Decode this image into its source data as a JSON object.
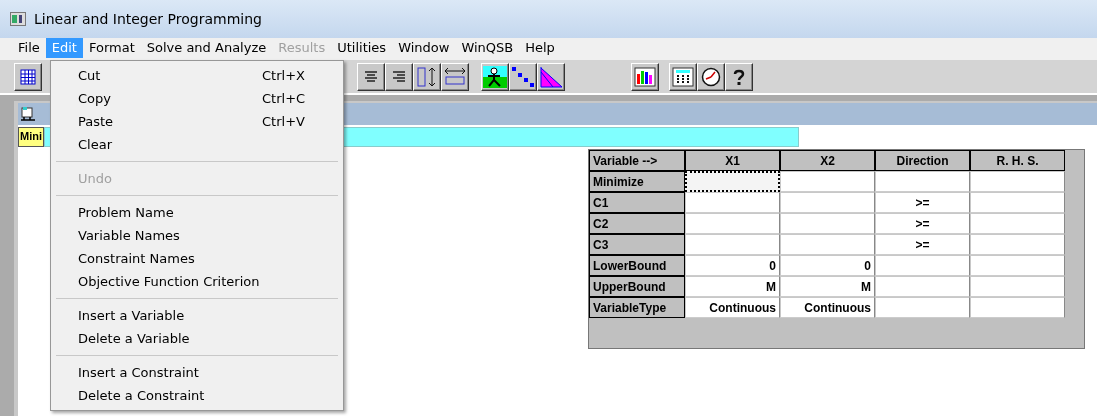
{
  "window": {
    "title": "Linear and Integer Programming"
  },
  "menu_bar": [
    {
      "label": "File",
      "selected": false,
      "disabled": false
    },
    {
      "label": "Edit",
      "selected": true,
      "disabled": false
    },
    {
      "label": "Format",
      "selected": false,
      "disabled": false
    },
    {
      "label": "Solve and Analyze",
      "selected": false,
      "disabled": false
    },
    {
      "label": "Results",
      "selected": false,
      "disabled": true
    },
    {
      "label": "Utilities",
      "selected": false,
      "disabled": false
    },
    {
      "label": "Window",
      "selected": false,
      "disabled": false
    },
    {
      "label": "WinQSB",
      "selected": false,
      "disabled": false
    },
    {
      "label": "Help",
      "selected": false,
      "disabled": false
    }
  ],
  "edit_menu": [
    [
      {
        "label": "Cut",
        "shortcut": "Ctrl+X",
        "disabled": false
      },
      {
        "label": "Copy",
        "shortcut": "Ctrl+C",
        "disabled": false
      },
      {
        "label": "Paste",
        "shortcut": "Ctrl+V",
        "disabled": false
      },
      {
        "label": "Clear",
        "disabled": false
      }
    ],
    [
      {
        "label": "Undo",
        "disabled": true
      }
    ],
    [
      {
        "label": "Problem Name",
        "disabled": false
      },
      {
        "label": "Variable Names",
        "disabled": false
      },
      {
        "label": "Constraint Names",
        "disabled": false
      },
      {
        "label": "Objective Function Criterion",
        "disabled": false
      }
    ],
    [
      {
        "label": "Insert a Variable",
        "disabled": false
      },
      {
        "label": "Delete a Variable",
        "disabled": false
      }
    ],
    [
      {
        "label": "Insert a Constraint",
        "disabled": false
      },
      {
        "label": "Delete a Constraint",
        "disabled": false
      }
    ]
  ],
  "document": {
    "cell_label": "Mini",
    "table": {
      "columns": [
        "Variable -->",
        "X1",
        "X2",
        "Direction",
        "R. H. S."
      ],
      "rows": [
        {
          "cells": [
            {
              "kind": "header",
              "text": "Minimize"
            },
            {
              "focused": true
            },
            {
              "focused": false
            },
            {
              "focused": false
            },
            {
              "focused": false
            }
          ]
        },
        {
          "cells": [
            {
              "kind": "header",
              "text": "C1"
            },
            {
              "focused": false
            },
            {
              "focused": false
            },
            {
              "text": ">=",
              "focused": false
            },
            {
              "focused": false
            }
          ]
        },
        {
          "cells": [
            {
              "kind": "header",
              "text": "C2"
            },
            {
              "focused": false
            },
            {
              "focused": false
            },
            {
              "text": ">=",
              "focused": false
            },
            {
              "focused": false
            }
          ]
        },
        {
          "cells": [
            {
              "kind": "header",
              "text": "C3"
            },
            {
              "focused": false
            },
            {
              "focused": false
            },
            {
              "text": ">=",
              "focused": false
            },
            {
              "focused": false
            }
          ]
        },
        {
          "cells": [
            {
              "kind": "header",
              "text": "LowerBound"
            },
            {
              "text": "0",
              "focused": false
            },
            {
              "text": "0",
              "focused": false
            },
            {
              "focused": false
            },
            {
              "focused": false
            }
          ]
        },
        {
          "cells": [
            {
              "kind": "header",
              "text": "UpperBound"
            },
            {
              "text": "M",
              "focused": false
            },
            {
              "text": "M",
              "focused": false
            },
            {
              "focused": false
            },
            {
              "focused": false
            }
          ]
        },
        {
          "cells": [
            {
              "kind": "header",
              "text": "VariableType"
            },
            {
              "text": "Continuous",
              "focused": false
            },
            {
              "text": "Continuous",
              "focused": false
            },
            {
              "focused": false
            },
            {
              "focused": false
            }
          ]
        }
      ]
    }
  }
}
